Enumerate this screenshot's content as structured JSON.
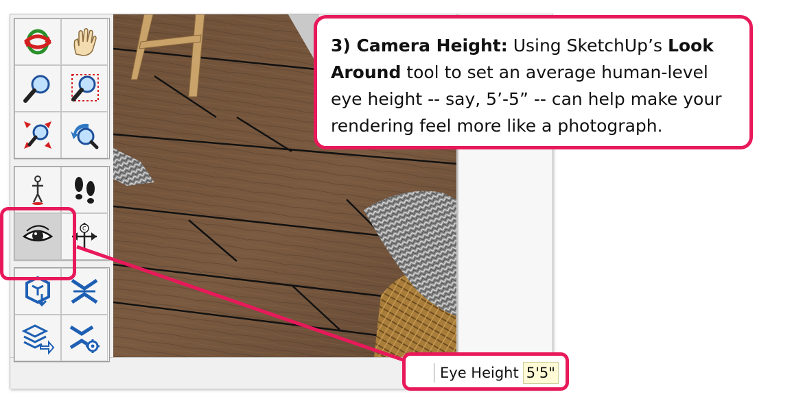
{
  "callout": {
    "step": "3) Camera Height:",
    "text1": " Using SketchUp’s ",
    "bold1": "Look Around",
    "text2": " tool to set an average human-level eye height -- say, 5’-5” -- can help make your rendering feel more like a photograph."
  },
  "toolbar": {
    "groups": [
      [
        [
          "orbit-icon",
          "pan-icon"
        ],
        [
          "zoom-icon",
          "zoom-window-icon"
        ],
        [
          "zoom-extents-icon",
          "previous-view-icon"
        ]
      ],
      [
        [
          "position-camera-icon",
          "walk-icon"
        ],
        [
          "look-around-icon",
          "section-plane-icon"
        ]
      ],
      [
        [
          "export-3d-icon",
          "scene-icon"
        ],
        [
          "layers-export-icon",
          "scene-settings-icon"
        ]
      ]
    ],
    "active_tool": "look-around-icon"
  },
  "status": {
    "label": "Eye Height",
    "value": "5'5\""
  },
  "colors": {
    "highlight": "#e8195a",
    "floor": "#6b4e38",
    "vcb_background": "#fffbd6"
  }
}
